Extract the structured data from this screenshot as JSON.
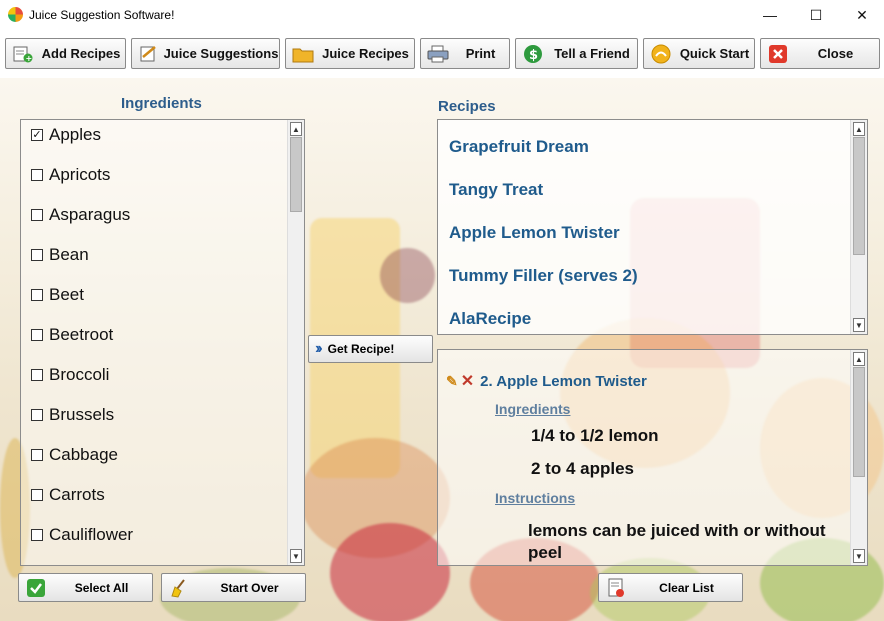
{
  "window": {
    "title": "Juice Suggestion Software!",
    "minimize": "—",
    "maximize": "☐",
    "close": "✕"
  },
  "toolbar": [
    {
      "label": "Add Recipes",
      "icon": "add-recipes-icon"
    },
    {
      "label": "Juice Suggestions",
      "icon": "suggestions-icon"
    },
    {
      "label": "Juice Recipes",
      "icon": "folder-icon"
    },
    {
      "label": "Print",
      "icon": "printer-icon"
    },
    {
      "label": "Tell a Friend",
      "icon": "dollar-icon"
    },
    {
      "label": "Quick Start",
      "icon": "quick-start-icon"
    },
    {
      "label": "Close",
      "icon": "close-icon"
    }
  ],
  "ingredients": {
    "title": "Ingredients",
    "items": [
      {
        "label": "Apples",
        "checked": true
      },
      {
        "label": "Apricots",
        "checked": false
      },
      {
        "label": "Asparagus",
        "checked": false
      },
      {
        "label": "Bean",
        "checked": false
      },
      {
        "label": "Beet",
        "checked": false
      },
      {
        "label": "Beetroot",
        "checked": false
      },
      {
        "label": "Broccoli",
        "checked": false
      },
      {
        "label": "Brussels",
        "checked": false
      },
      {
        "label": "Cabbage",
        "checked": false
      },
      {
        "label": "Carrots",
        "checked": false
      },
      {
        "label": "Cauliflower",
        "checked": false
      }
    ],
    "select_all": "Select All",
    "start_over": "Start Over"
  },
  "recipes": {
    "title": "Recipes",
    "items": [
      "Grapefruit Dream",
      "Tangy Treat",
      "Apple Lemon Twister",
      "Tummy Filler (serves 2)",
      "AlaRecipe"
    ],
    "get_recipe": "Get Recipe!"
  },
  "detail": {
    "heading": "2. Apple Lemon Twister",
    "ingredients_label": "Ingredients",
    "ingredient_lines": [
      "1/4 to 1/2 lemon",
      "2 to 4 apples"
    ],
    "instructions_label": "Instructions",
    "instructions": "lemons can be juiced with or without peel",
    "clear_list": "Clear List"
  },
  "colors": {
    "accent": "#1f5b8c",
    "section_title": "#2d5d8c"
  }
}
